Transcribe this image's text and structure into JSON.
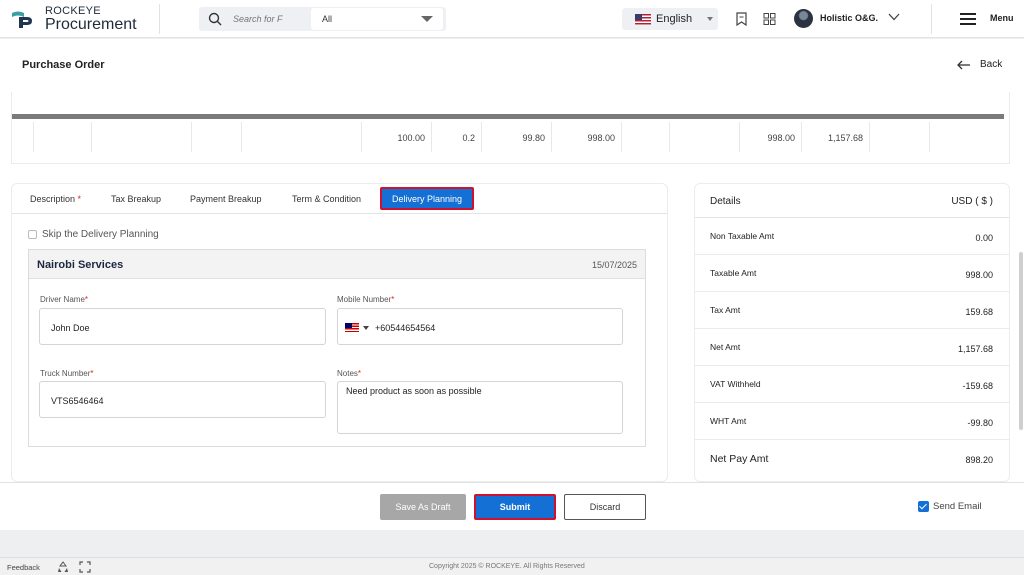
{
  "brand": {
    "top": "ROCKEYE",
    "bottom": "Procurement"
  },
  "search": {
    "placeholder": "Search for F",
    "scope": "All"
  },
  "header": {
    "language": "English",
    "user": "Holistic O&G.",
    "menu_label": "Menu"
  },
  "page": {
    "title": "Purchase Order",
    "back_label": "Back"
  },
  "table_row": [
    "",
    "",
    "",
    "",
    "",
    "100.00",
    "0.2",
    "99.80",
    "998.00",
    "",
    "",
    "998.00",
    "1,157.68",
    "",
    ""
  ],
  "tabs": {
    "description": "Description",
    "description_req": "*",
    "tax_breakup": "Tax Breakup",
    "payment_breakup": "Payment Breakup",
    "terms": "Term & Condition",
    "delivery": "Delivery Planning"
  },
  "delivery": {
    "skip_label": "Skip the Delivery Planning",
    "vendor_name": "Nairobi Services",
    "date": "15/07/2025",
    "driver_label": "Driver Name",
    "driver_value": "John Doe",
    "mobile_label": "Mobile Number",
    "mobile_value": "+60544654564",
    "truck_label": "Truck Number",
    "truck_value": "VTS6546464",
    "notes_label": "Notes",
    "notes_value": "Need product as soon as possible",
    "req": "*"
  },
  "details": {
    "title": "Details",
    "currency": "USD ( $ )",
    "rows": [
      {
        "label": "Non Taxable Amt",
        "value": "0.00"
      },
      {
        "label": "Taxable Amt",
        "value": "998.00"
      },
      {
        "label": "Tax Amt",
        "value": "159.68"
      },
      {
        "label": "Net Amt",
        "value": "1,157.68"
      },
      {
        "label": "VAT Withheld",
        "value": "-159.68"
      },
      {
        "label": "WHT Amt",
        "value": "-99.80"
      },
      {
        "label": "Net Pay Amt",
        "value": "898.20"
      }
    ]
  },
  "actions": {
    "save_draft": "Save As Draft",
    "submit": "Submit",
    "discard": "Discard",
    "send_email": "Send Email"
  },
  "footer": {
    "feedback": "Feedback",
    "copyright": "Copyright 2025 © ROCKEYE. All Rights Reserved"
  },
  "colors": {
    "primary": "#1570d6",
    "highlight_border": "#d0112b",
    "draft_gray": "#a7a7a7"
  }
}
